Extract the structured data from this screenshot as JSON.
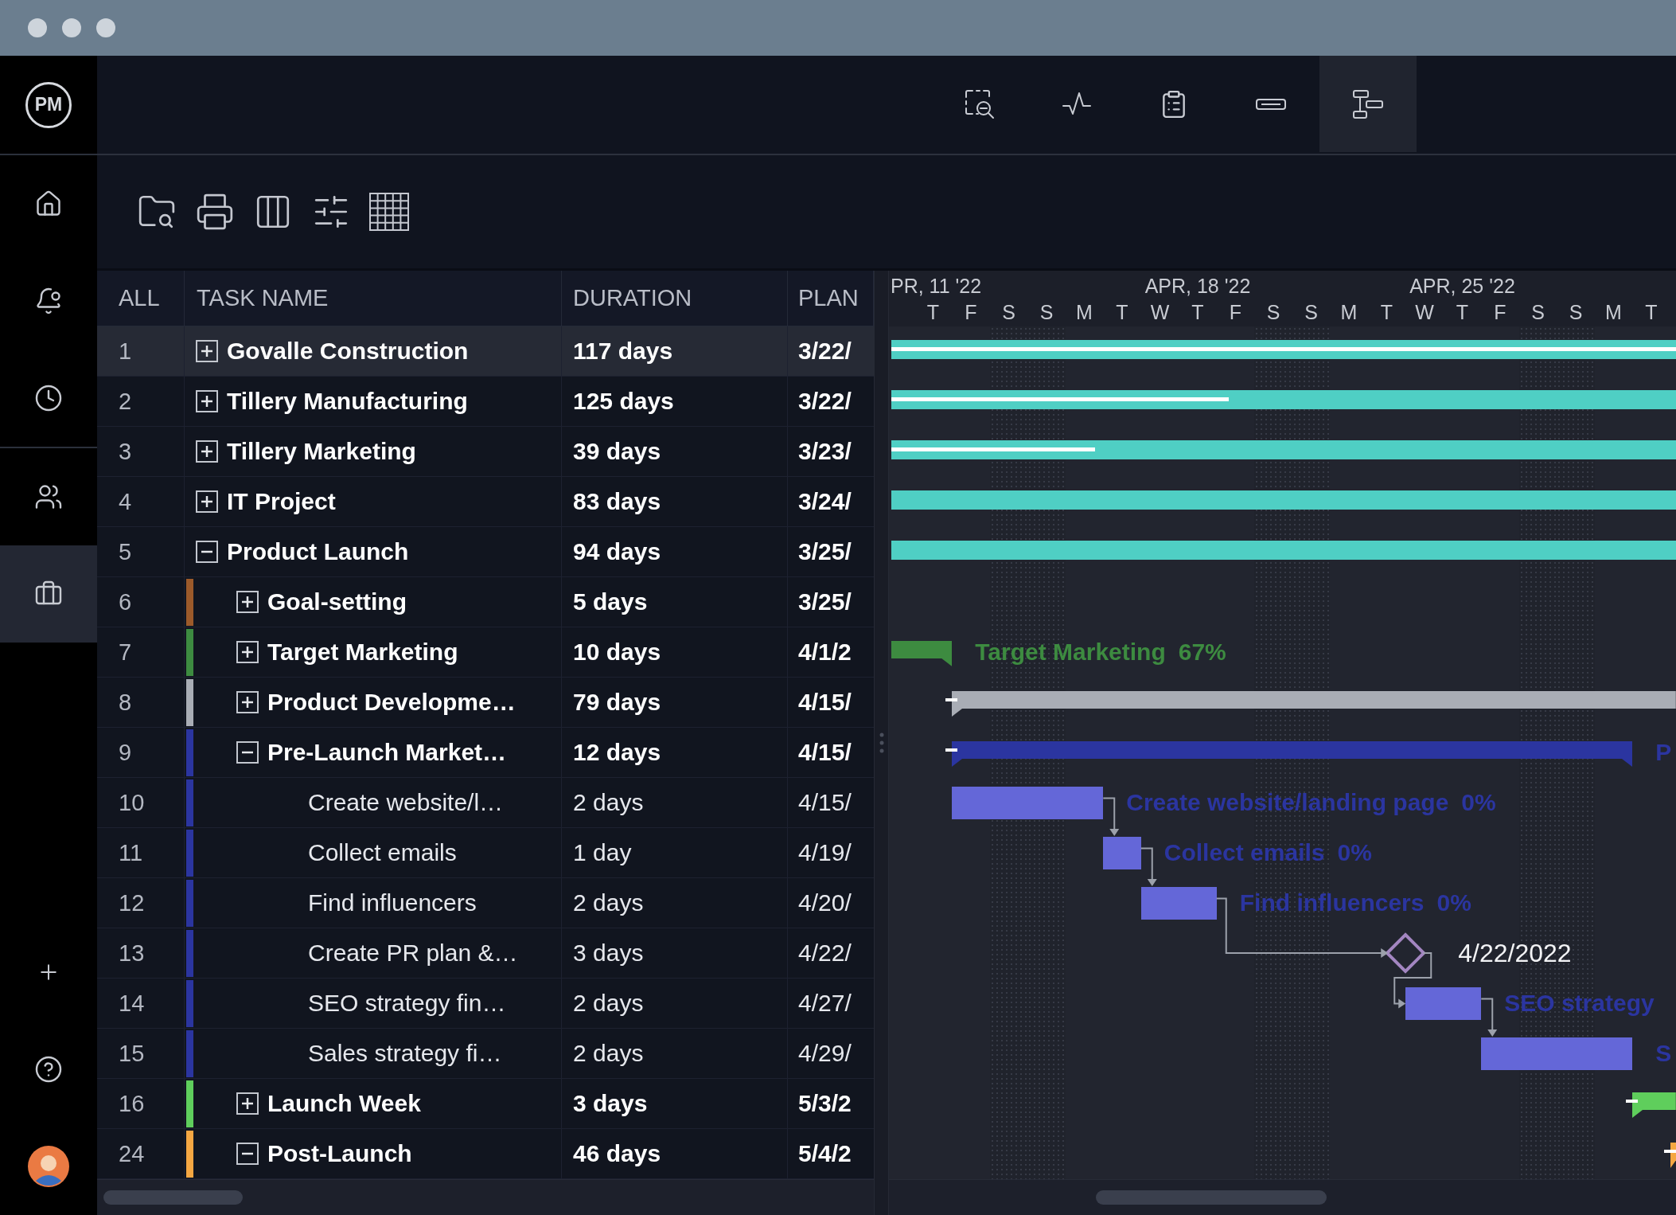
{
  "sidebar": {
    "logo": "PM",
    "items": [
      {
        "selected": false
      },
      {
        "selected": false
      },
      {
        "selected": false
      },
      {
        "selected": false
      },
      {
        "selected": true
      }
    ]
  },
  "view_switcher": {
    "items": [
      {
        "selected": false
      },
      {
        "selected": false
      },
      {
        "selected": false
      },
      {
        "selected": false
      },
      {
        "selected": true
      }
    ]
  },
  "table": {
    "columns": [
      "ALL",
      "TASK NAME",
      "DURATION",
      "PLAN"
    ],
    "rows": [
      {
        "id": "1",
        "name": "Govalle Construction",
        "duration": "117 days",
        "planned": "3/22/",
        "kind": "group",
        "expanded": false,
        "selected": true,
        "bar": {
          "kind": "project",
          "level": 1
        }
      },
      {
        "id": "2",
        "name": "Tillery Manufacturing",
        "duration": "125 days",
        "planned": "3/22/",
        "kind": "group",
        "expanded": false,
        "selected": false,
        "bar": {
          "kind": "project",
          "level": 0.43
        }
      },
      {
        "id": "3",
        "name": "Tillery Marketing",
        "duration": "39 days",
        "planned": "3/23/",
        "kind": "group",
        "expanded": false,
        "selected": false,
        "bar": {
          "kind": "project",
          "level": 0.26
        }
      },
      {
        "id": "4",
        "name": "IT Project",
        "duration": "83 days",
        "planned": "3/24/",
        "kind": "group",
        "expanded": false,
        "selected": false,
        "bar": {
          "kind": "project"
        }
      },
      {
        "id": "5",
        "name": "Product Launch",
        "duration": "94 days",
        "planned": "3/25/",
        "kind": "group",
        "expanded": true,
        "selected": false,
        "bar": {
          "kind": "project"
        },
        "children": [
          {
            "id": "6",
            "name": "Goal-setting",
            "duration": "5 days",
            "planned": "3/25/",
            "kind": "group",
            "expanded": false,
            "selected": false,
            "color": "#9c5a2a"
          },
          {
            "id": "7",
            "name": "Target Marketing",
            "duration": "10 days",
            "planned": "4/1/2",
            "kind": "group",
            "expanded": false,
            "selected": false,
            "color": "#3d8b40",
            "bar": {
              "kind": "summary",
              "label": "Target Marketing",
              "percent": "67%"
            }
          },
          {
            "id": "8",
            "name": "Product Developme…",
            "duration": "79 days",
            "planned": "4/15/",
            "kind": "group",
            "expanded": false,
            "selected": false,
            "color": "#a9adb5",
            "bar": {
              "kind": "summary"
            }
          },
          {
            "id": "9",
            "name": "Pre-Launch Market…",
            "duration": "12 days",
            "planned": "4/15/",
            "kind": "group",
            "expanded": true,
            "selected": false,
            "color": "#2b35a0",
            "bar": {
              "kind": "summary",
              "label": "P"
            },
            "children": [
              {
                "id": "10",
                "name": "Create website/l…",
                "duration": "2 days",
                "planned": "4/15/",
                "kind": "task",
                "selected": false,
                "bar": {
                  "kind": "task",
                  "label": "Create website/landing page",
                  "percent": "0%",
                  "linked": false
                }
              },
              {
                "id": "11",
                "name": "Collect emails",
                "duration": "1 day",
                "planned": "4/19/",
                "kind": "task",
                "selected": false,
                "bar": {
                  "kind": "task",
                  "label": "Collect emails",
                  "percent": "0%",
                  "linked": true
                }
              },
              {
                "id": "12",
                "name": "Find influencers",
                "duration": "2 days",
                "planned": "4/20/",
                "kind": "task",
                "selected": false,
                "bar": {
                  "kind": "task",
                  "label": "Find influencers",
                  "percent": "0%",
                  "linked": true
                }
              },
              {
                "id": "13",
                "name": "Create PR plan &…",
                "duration": "3 days",
                "planned": "4/22/",
                "kind": "task",
                "selected": false,
                "bar": {
                  "kind": "milestone",
                  "label": "4/22/2022",
                  "linked": true
                }
              },
              {
                "id": "14",
                "name": "SEO strategy fin…",
                "duration": "2 days",
                "planned": "4/27/",
                "kind": "task",
                "selected": false,
                "bar": {
                  "kind": "task",
                  "label": "SEO strategy",
                  "linked": true
                }
              },
              {
                "id": "15",
                "name": "Sales strategy fi…",
                "duration": "2 days",
                "planned": "4/29/",
                "kind": "task",
                "selected": false,
                "bar": {
                  "kind": "task",
                  "label": "S",
                  "linked": true
                }
              }
            ]
          },
          {
            "id": "16",
            "name": "Launch Week",
            "duration": "3 days",
            "planned": "5/3/2",
            "kind": "group",
            "expanded": false,
            "selected": false,
            "color": "#5fce5c",
            "bar": {
              "kind": "summary"
            }
          },
          {
            "id": "24",
            "name": "Post-Launch",
            "duration": "46 days",
            "planned": "5/4/2",
            "kind": "group",
            "expanded": true,
            "selected": false,
            "color": "#f5a742",
            "bar": {
              "kind": "summary"
            }
          }
        ]
      }
    ]
  },
  "gantt": {
    "weeks": [
      "PR, 11 '22",
      "APR, 18 '22",
      "APR, 25 '22"
    ],
    "days": [
      {
        "label": "T",
        "weekend": false
      },
      {
        "label": "F",
        "weekend": false
      },
      {
        "label": "S",
        "weekend": true
      },
      {
        "label": "S",
        "weekend": true
      },
      {
        "label": "M",
        "weekend": false
      },
      {
        "label": "T",
        "weekend": false
      },
      {
        "label": "W",
        "weekend": false
      },
      {
        "label": "T",
        "weekend": false
      },
      {
        "label": "F",
        "weekend": false
      },
      {
        "label": "S",
        "weekend": true
      },
      {
        "label": "S",
        "weekend": true
      },
      {
        "label": "M",
        "weekend": false
      },
      {
        "label": "T",
        "weekend": false
      },
      {
        "label": "W",
        "weekend": false
      },
      {
        "label": "T",
        "weekend": false
      },
      {
        "label": "F",
        "weekend": false
      },
      {
        "label": "S",
        "weekend": true
      },
      {
        "label": "S",
        "weekend": true
      },
      {
        "label": "M",
        "weekend": false
      },
      {
        "label": "T",
        "weekend": false
      }
    ]
  }
}
